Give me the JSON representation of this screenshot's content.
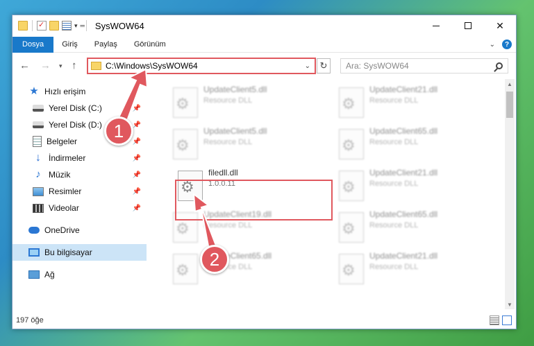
{
  "window": {
    "title": "SysWOW64",
    "controls": {
      "minimize": "",
      "maximize": "",
      "close": "✕"
    }
  },
  "ribbon": {
    "tabs": [
      "Dosya",
      "Giriş",
      "Paylaş",
      "Görünüm"
    ],
    "help": "?"
  },
  "address": {
    "path": "C:\\Windows\\SysWOW64",
    "search_placeholder": "Ara: SysWOW64"
  },
  "nav": {
    "items": [
      {
        "label": "Hızlı erişim",
        "icon": "star-icon",
        "pinned": false
      },
      {
        "label": "Yerel Disk (C:)",
        "icon": "disk-icon",
        "pinned": true
      },
      {
        "label": "Yerel Disk (D:)",
        "icon": "disk-icon",
        "pinned": true
      },
      {
        "label": "Belgeler",
        "icon": "document-icon",
        "pinned": true
      },
      {
        "label": "İndirmeler",
        "icon": "download-icon",
        "pinned": true
      },
      {
        "label": "Müzik",
        "icon": "music-icon",
        "pinned": true
      },
      {
        "label": "Resimler",
        "icon": "pictures-icon",
        "pinned": true
      },
      {
        "label": "Videolar",
        "icon": "videos-icon",
        "pinned": true
      },
      {
        "label": "OneDrive",
        "icon": "cloud-icon",
        "pinned": false
      },
      {
        "label": "Bu bilgisayar",
        "icon": "computer-icon",
        "pinned": false,
        "selected": true
      },
      {
        "label": "Ağ",
        "icon": "network-icon",
        "pinned": false
      }
    ]
  },
  "files": {
    "left": [
      {
        "name": "UpdateClient5.dll",
        "sub": "Resource DLL"
      },
      {
        "name": "UpdateClient5.dll",
        "sub": "Resource DLL"
      },
      {
        "name": "filedll.dll",
        "sub": "1.0.0.11",
        "highlighted": true
      },
      {
        "name": "UpdateClient19.dll",
        "sub": "Resource DLL"
      },
      {
        "name": "UpdateClient65.dll",
        "sub": "Resource DLL"
      }
    ],
    "right": [
      {
        "name": "UpdateClient21.dll",
        "sub": "Resource DLL"
      },
      {
        "name": "UpdateClient65.dll",
        "sub": "Resource DLL"
      },
      {
        "name": "UpdateClient21.dll",
        "sub": "Resource DLL"
      },
      {
        "name": "UpdateClient65.dll",
        "sub": "Resource DLL"
      },
      {
        "name": "UpdateClient21.dll",
        "sub": "Resource DLL"
      }
    ]
  },
  "status": {
    "count": "197 öğe"
  },
  "annotations": {
    "badge1": "1",
    "badge2": "2",
    "accent": "#e0585e"
  }
}
